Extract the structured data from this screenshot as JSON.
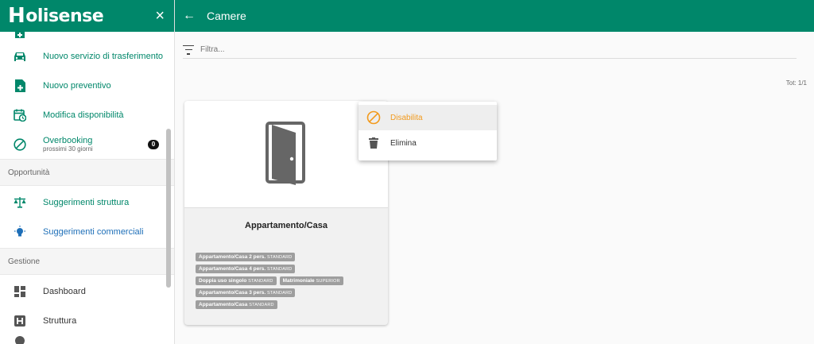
{
  "sidebar": {
    "logo": "olisense",
    "logo_initial": "H",
    "close_icon": "×",
    "items_top": [
      {
        "label": "Nuovo servizio di trasferimento",
        "icon": "car-icon"
      },
      {
        "label": "Nuovo preventivo",
        "icon": "file-plus-icon"
      },
      {
        "label": "Modifica disponibilità",
        "icon": "calendar-clock-icon"
      },
      {
        "label": "Overbooking",
        "sub": "prossimi 30 giorni",
        "badge": "0",
        "icon": "block-icon"
      }
    ],
    "section_opportunita": "Opportunità",
    "items_opportunita": [
      {
        "label": "Suggerimenti struttura",
        "icon": "scale-icon"
      },
      {
        "label": "Suggerimenti commerciali",
        "icon": "bulb-icon"
      }
    ],
    "section_gestione": "Gestione",
    "items_gestione": [
      {
        "label": "Dashboard",
        "icon": "dashboard-icon"
      },
      {
        "label": "Struttura",
        "icon": "hotel-h-icon"
      }
    ]
  },
  "topbar": {
    "back_icon": "←",
    "title": "Camere"
  },
  "filter": {
    "placeholder": "Filtra..."
  },
  "tot": "Tot: 1/1",
  "card": {
    "title": "Appartamento/Casa",
    "tags": [
      {
        "name": "Appartamento/Casa 2 pers.",
        "quality": "STANDARD"
      },
      {
        "name": "Appartamento/Casa 4 pers.",
        "quality": "STANDARD"
      },
      {
        "name": "Doppia uso singolo",
        "quality": "STANDARD"
      },
      {
        "name": "Matrimoniale",
        "quality": "SUPERIOR"
      },
      {
        "name": "Appartamento/Casa 3 pers.",
        "quality": "STANDARD"
      },
      {
        "name": "Appartamento/Casa",
        "quality": "STANDARD"
      }
    ]
  },
  "menu": {
    "items": [
      {
        "label": "Disabilita",
        "icon": "block-icon"
      },
      {
        "label": "Elimina",
        "icon": "trash-icon"
      }
    ]
  },
  "colors": {
    "primary": "#00876a",
    "link_blue": "#1e6fb8",
    "accent_orange": "#f29a1d"
  }
}
